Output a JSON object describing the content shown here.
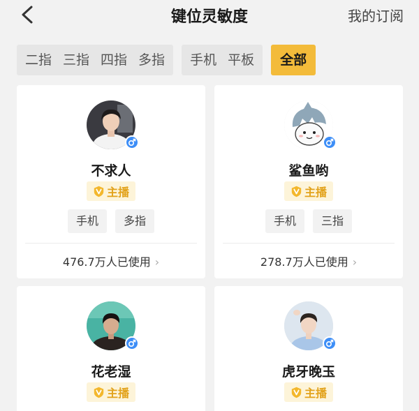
{
  "header": {
    "title": "键位灵敏度",
    "subscribe_label": "我的订阅"
  },
  "filters": {
    "fingers": [
      "二指",
      "三指",
      "四指",
      "多指"
    ],
    "devices": [
      "手机",
      "平板"
    ],
    "all_label": "全部"
  },
  "cards": [
    {
      "name": "不求人",
      "badge": "主播",
      "tags": [
        "手机",
        "多指"
      ],
      "usage": "476.7万人已使用"
    },
    {
      "name": "鲨鱼哟",
      "badge": "主播",
      "tags": [
        "手机",
        "三指"
      ],
      "usage": "278.7万人已使用"
    },
    {
      "name": "花老湿",
      "badge": "主播"
    },
    {
      "name": "虎牙晚玉",
      "badge": "主播"
    }
  ],
  "colors": {
    "accent": "#f3bb3a",
    "badge_text": "#e2a21b",
    "gender_male": "#3d8ef7"
  }
}
